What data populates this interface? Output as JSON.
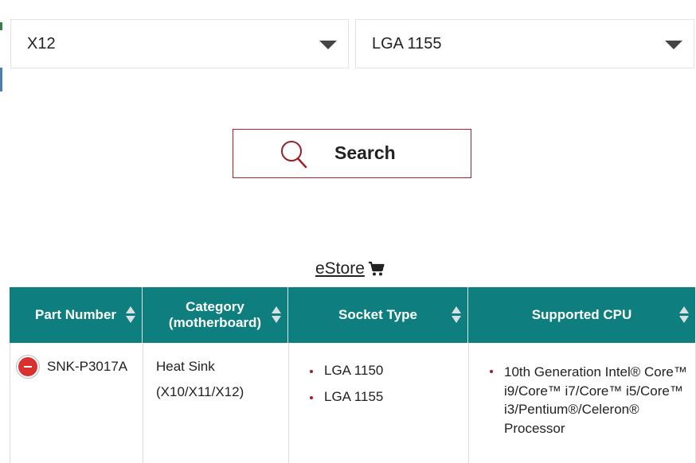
{
  "filters": {
    "series_value": "X12",
    "socket_value": "LGA 1155"
  },
  "search_button": {
    "label": "Search"
  },
  "estore": {
    "label": "eStore"
  },
  "table": {
    "headers": {
      "part_number": "Part Number",
      "category_line1": "Category",
      "category_line2": "(motherboard)",
      "socket_type": "Socket Type",
      "supported_cpu": "Supported CPU"
    },
    "rows": [
      {
        "part_number": "SNK-P3017A",
        "category_line1": "Heat Sink",
        "category_line2": "(X10/X11/X12)",
        "socket_types": [
          "LGA 1150",
          "LGA 1155"
        ],
        "supported_cpu": [
          "10th Generation Intel® Core™ i9/Core™ i7/Core™ i5/Core™ i3/Pentium®/Celeron® Processor"
        ]
      }
    ]
  },
  "colors": {
    "header_bg": "#0f7e7e",
    "accent": "#b0202a",
    "collapse": "#d93030"
  },
  "icons": {
    "search": "search-icon",
    "cart": "cart-icon",
    "dropdown": "chevron-down-icon",
    "sort": "sort-icon",
    "collapse": "minus-circle-icon"
  }
}
